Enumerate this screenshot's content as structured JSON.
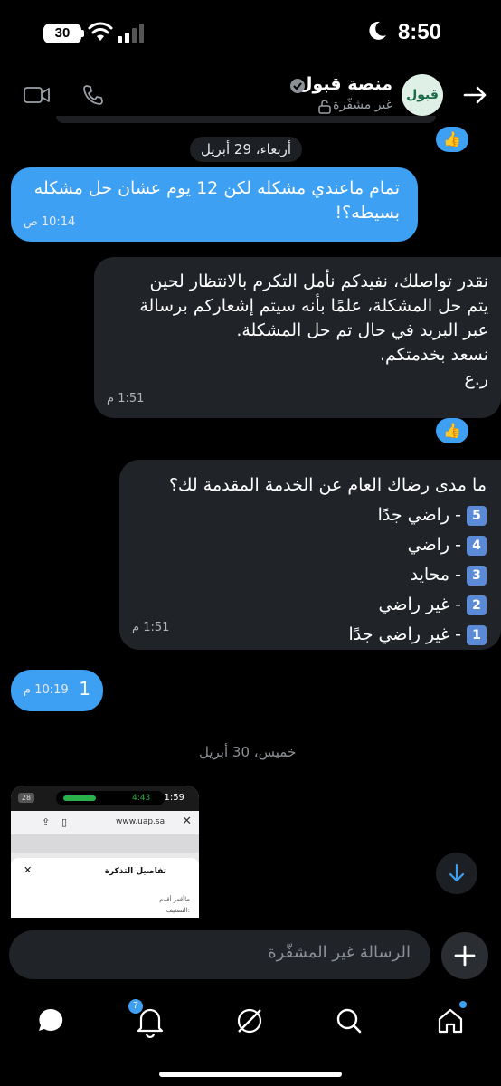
{
  "status_bar": {
    "time": "8:50",
    "battery": "30"
  },
  "header": {
    "name": "منصة قبول",
    "subtitle": "غير مشفّرة",
    "logo_text": "قبول"
  },
  "reactions": {
    "thumbs": "👍"
  },
  "date_separators": {
    "first": "أربعاء، 29 أبريل",
    "second": "خميس، 30 أبريل"
  },
  "messages": {
    "m1": {
      "text": "تمام ماعندي مشكله لكن 12 يوم عشان حل مشكله بسيطه؟!",
      "time": "10:14 ص"
    },
    "m2": {
      "lines": [
        "نقدر تواصلك، نفيدكم نأمل التكرم بالانتظار لحين",
        "يتم حل المشكلة، علمًا بأنه سيتم إشعاركم برسالة",
        "عبر البريد في حال تم حل المشكلة.",
        "نسعد بخدمتكم.",
        "ر.ع"
      ],
      "time": "1:51 م"
    },
    "m3": {
      "question": "ما مدى رضاك العام عن الخدمة المقدمة لك؟",
      "options": [
        {
          "num": "5",
          "label": "- راضي جدًا"
        },
        {
          "num": "4",
          "label": "- راضي"
        },
        {
          "num": "3",
          "label": "- محايد"
        },
        {
          "num": "2",
          "label": "- غير راضي"
        },
        {
          "num": "1",
          "label": "- غير راضي جدًا"
        }
      ],
      "time": "1:51 م"
    },
    "m4": {
      "text": "1",
      "time": "10:19 م"
    }
  },
  "preview": {
    "battery": "28",
    "call_time": "4:43",
    "clock": "1:59",
    "url": "www.uap.sa",
    "sheet_title": "تفاصيل التذكرة",
    "line1": "ماأقدر أقدم",
    "line2": "التصنيف:"
  },
  "composer": {
    "placeholder": "الرسالة غير المشفّرة"
  },
  "tabbar": {
    "notifications_badge": "7"
  },
  "colors": {
    "accent": "#3ea0f3",
    "bubble_dark": "#202327",
    "background": "#000000"
  }
}
